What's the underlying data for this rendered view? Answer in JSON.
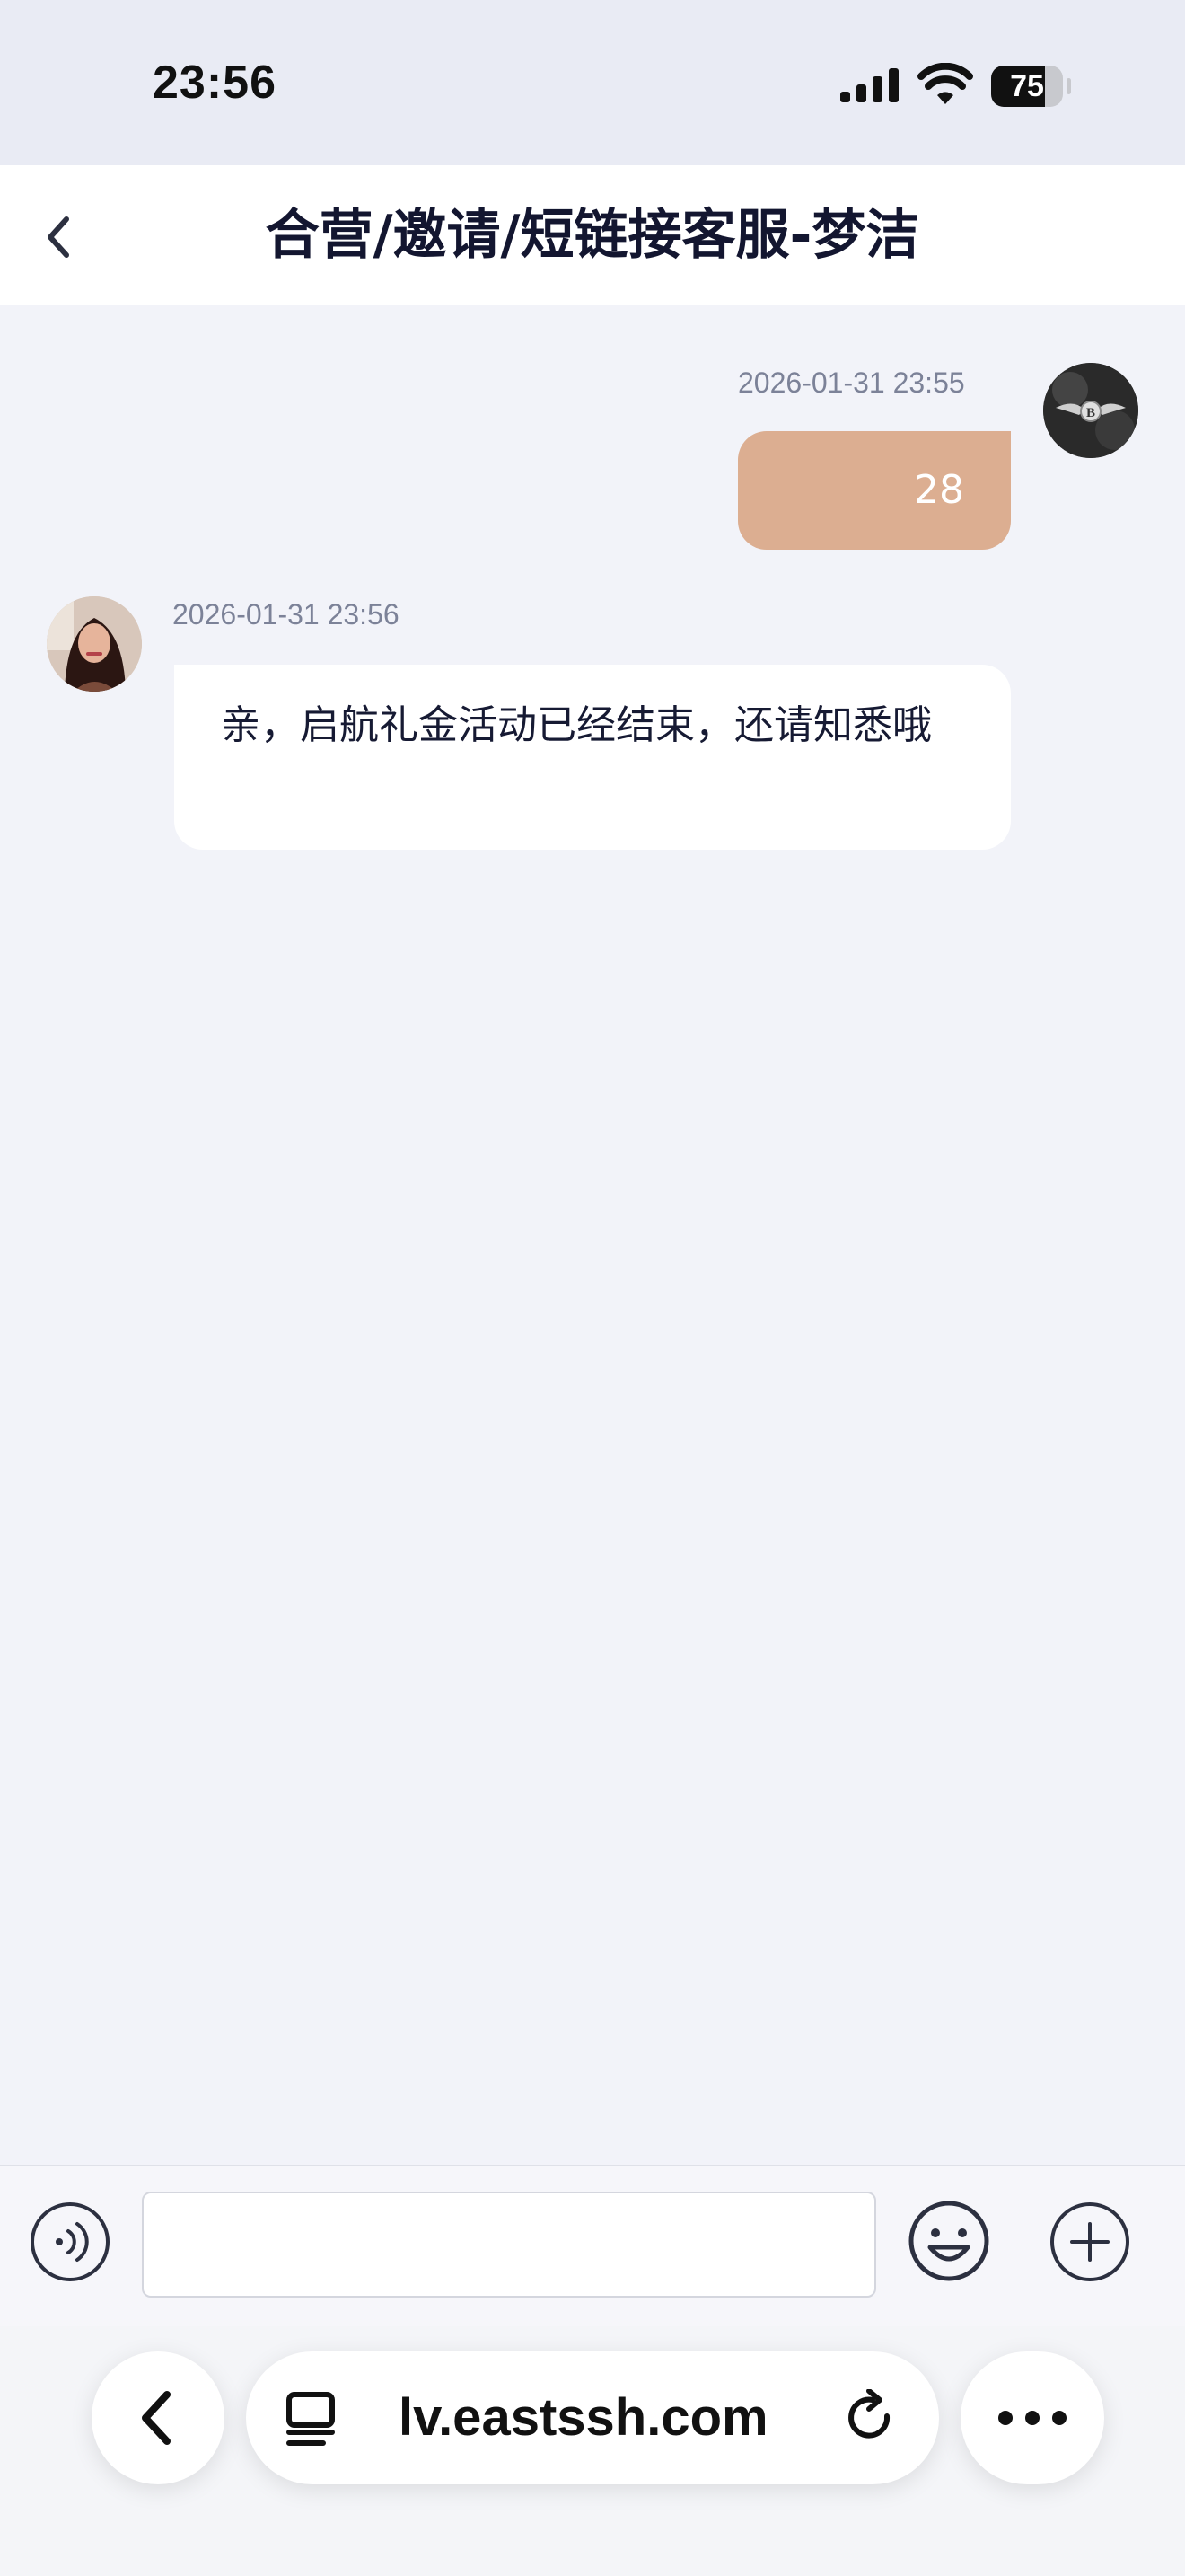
{
  "status_bar": {
    "time": "23:56",
    "battery_level": "75",
    "battery_fraction": 0.75
  },
  "header": {
    "title": "合营/邀请/短链接客服-梦洁"
  },
  "messages": [
    {
      "direction": "outgoing",
      "timestamp": "2026-01-31 23:55",
      "text": "28"
    },
    {
      "direction": "incoming",
      "timestamp": "2026-01-31 23:56",
      "text": "亲，启航礼金活动已经结束，还请知悉哦"
    }
  ],
  "input": {
    "value": "",
    "placeholder": ""
  },
  "browser": {
    "url": "lv.eastssh.com"
  },
  "colors": {
    "outgoing_bubble": "#dcae91",
    "background": "#f2f3f9",
    "header_bg": "#ffffff"
  },
  "icons": [
    "signal-icon",
    "wifi-icon",
    "battery-icon",
    "back-chevron-icon",
    "voice-icon",
    "emoji-icon",
    "plus-icon",
    "browser-back-icon",
    "tabs-icon",
    "reload-icon",
    "more-icon"
  ]
}
